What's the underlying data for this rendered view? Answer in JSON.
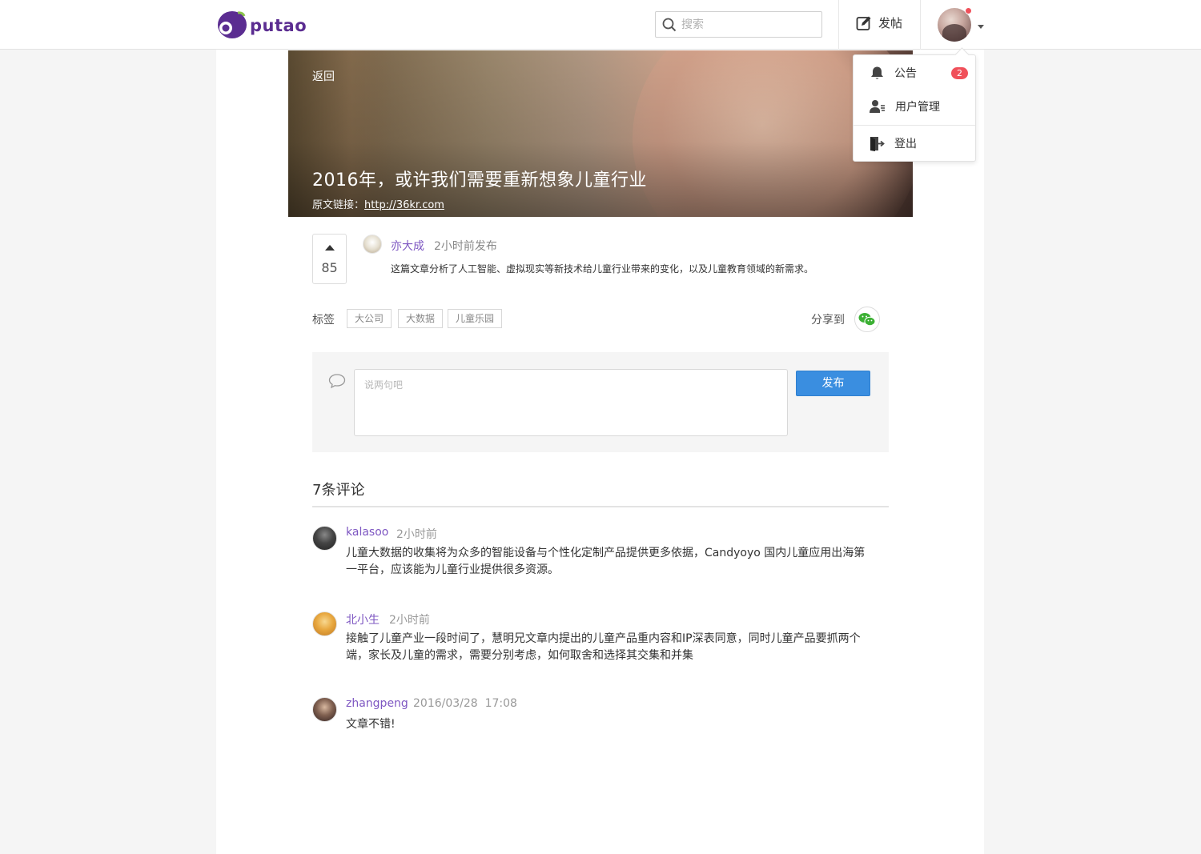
{
  "header": {
    "logo_text": "putao",
    "search_placeholder": "搜索",
    "post_label": "发帖"
  },
  "dropdown": {
    "items": [
      {
        "label": "公告",
        "icon": "bell-icon",
        "badge": "2"
      },
      {
        "label": "用户管理",
        "icon": "user-manage-icon"
      },
      {
        "label": "登出",
        "icon": "logout-icon"
      }
    ]
  },
  "hero": {
    "back_label": "返回",
    "title": "2016年，或许我们需要重新想象儿童行业",
    "source_label": "原文链接：",
    "source_url": "http://36kr.com"
  },
  "post": {
    "votes": "85",
    "author": "亦大成",
    "time": "2小时前发布",
    "summary": "这篇文章分析了人工智能、虚拟现实等新技术给儿童行业带来的变化，以及儿童教育领域的新需求。",
    "tags_label": "标签",
    "tags": [
      "大公司",
      "大数据",
      "儿童乐园"
    ],
    "share_label": "分享到"
  },
  "composer": {
    "placeholder": "说两句吧",
    "submit_label": "发布"
  },
  "comments": {
    "title": "7条评论",
    "items": [
      {
        "user": "kalasoo",
        "time": "2小时前",
        "text": "儿童大数据的收集将为众多的智能设备与个性化定制产品提供更多依据，Candyoyo 国内儿童应用出海第一平台，应该能为儿童行业提供很多资源。"
      },
      {
        "user": "北小生",
        "time": "2小时前",
        "text": "接触了儿童产业一段时间了，慧明兄文章内提出的儿童产品重内容和IP深表同意，同时儿童产品要抓两个端，家长及儿童的需求，需要分别考虑，如何取舍和选择其交集和并集"
      },
      {
        "user": "zhangpeng",
        "time": "2016/03/28  17:08",
        "text": "文章不错!"
      }
    ]
  },
  "colors": {
    "brand": "#5b2d91",
    "accent_link": "#7e57c2",
    "primary_button": "#3a8ee0",
    "badge": "#f0505a"
  }
}
